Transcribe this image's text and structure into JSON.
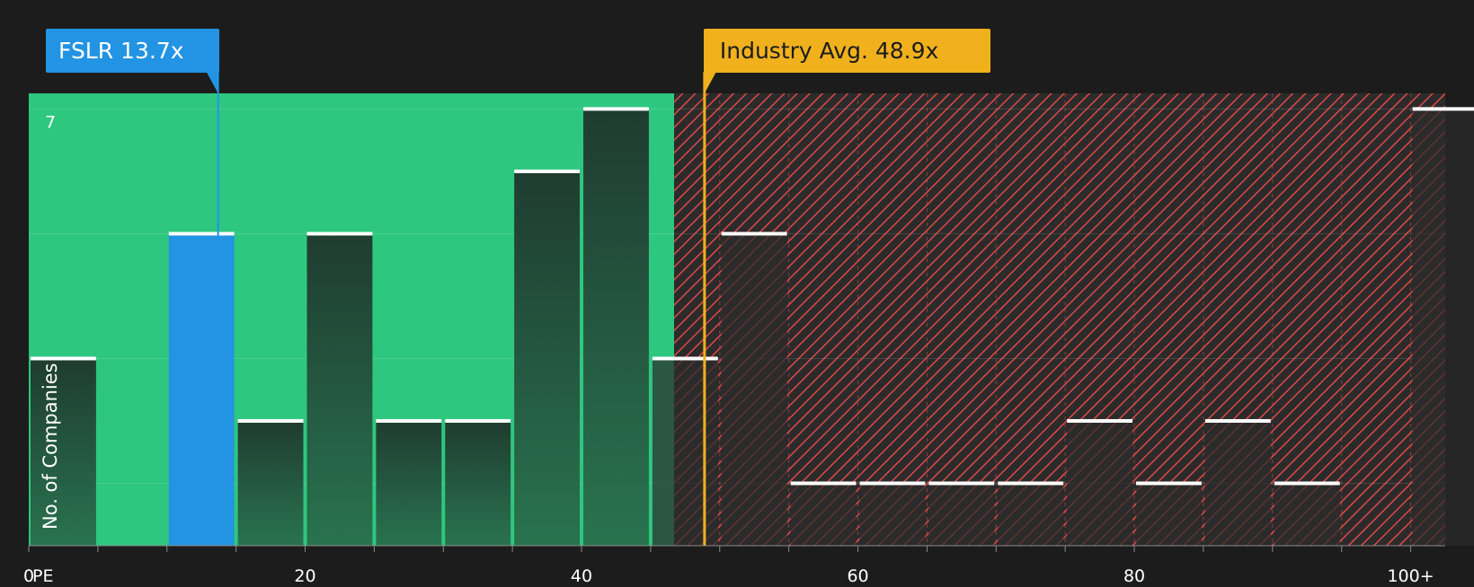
{
  "chart_data": {
    "type": "bar",
    "x_axis_label": "PE",
    "y_axis_label": "No. of Companies",
    "x_ticks": [
      "0",
      "20",
      "40",
      "60",
      "80",
      "100+"
    ],
    "y_ticks": [
      "7"
    ],
    "xlim": [
      0,
      102.5
    ],
    "ylim": [
      0,
      7.25
    ],
    "bin_width": 5,
    "bins": [
      {
        "start": 0,
        "count": 3
      },
      {
        "start": 5,
        "count": 0
      },
      {
        "start": 10,
        "count": 5,
        "highlight": true
      },
      {
        "start": 15,
        "count": 2
      },
      {
        "start": 20,
        "count": 5
      },
      {
        "start": 25,
        "count": 2
      },
      {
        "start": 30,
        "count": 2
      },
      {
        "start": 35,
        "count": 6
      },
      {
        "start": 40,
        "count": 7
      },
      {
        "start": 45,
        "count": 3
      },
      {
        "start": 50,
        "count": 5
      },
      {
        "start": 55,
        "count": 1
      },
      {
        "start": 60,
        "count": 1
      },
      {
        "start": 65,
        "count": 1
      },
      {
        "start": 70,
        "count": 1
      },
      {
        "start": 75,
        "count": 2
      },
      {
        "start": 80,
        "count": 1
      },
      {
        "start": 85,
        "count": 2
      },
      {
        "start": 90,
        "count": 1
      },
      {
        "start": 95,
        "count": 0
      },
      {
        "start": 100,
        "count": 7
      }
    ],
    "company": {
      "ticker": "FSLR",
      "pe": 13.7,
      "label": "FSLR 13.7x",
      "color": "#2394e3"
    },
    "industry_avg": {
      "pe": 48.9,
      "label": "Industry Avg. 48.9x",
      "color": "#f0b11c"
    },
    "fair_zone_end": 46.7,
    "colors": {
      "background": "#1c1c1c",
      "fair_zone": "#2ec77f",
      "over_zone": "#2b2b2b",
      "hatch": "#e04848",
      "bar_top": "#1f3c30",
      "bar_bottom": "#29734f",
      "bar_cap": "#ffffff"
    }
  }
}
